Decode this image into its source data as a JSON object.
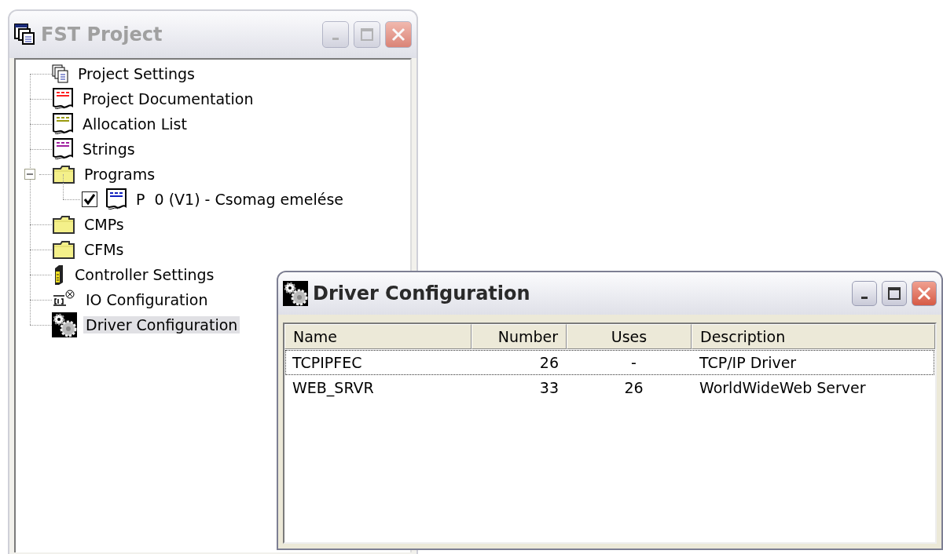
{
  "project_window": {
    "title": "FST Project",
    "active": false,
    "tree": [
      {
        "label": "Project Settings",
        "kind": "settings",
        "selected": false
      },
      {
        "label": "Project Documentation",
        "kind": "doc",
        "selected": false
      },
      {
        "label": "Allocation List",
        "kind": "alloc",
        "selected": false
      },
      {
        "label": "Strings",
        "kind": "strings",
        "selected": false
      },
      {
        "label": "Programs",
        "kind": "folder",
        "selected": false,
        "expanded": true,
        "children": [
          {
            "label": "P  0 (V1) - Csomag emelése",
            "kind": "program",
            "selected": false,
            "checked": true
          }
        ]
      },
      {
        "label": "CMPs",
        "kind": "folder",
        "selected": false
      },
      {
        "label": "CFMs",
        "kind": "folder",
        "selected": false
      },
      {
        "label": "Controller Settings",
        "kind": "controller",
        "selected": false
      },
      {
        "label": "IO Configuration",
        "kind": "io",
        "selected": false
      },
      {
        "label": "Driver Configuration",
        "kind": "driver",
        "selected": true
      }
    ]
  },
  "driver_window": {
    "title": "Driver Configuration",
    "active": true,
    "table": {
      "columns": [
        "Name",
        "Number",
        "Uses",
        "Description"
      ],
      "rows": [
        {
          "cells": [
            "TCPIPFEC",
            "26",
            "-",
            "TCP/IP Driver"
          ],
          "focused": true
        },
        {
          "cells": [
            "WEB_SRVR",
            "33",
            "26",
            "WorldWideWeb Server"
          ],
          "focused": false
        }
      ]
    }
  }
}
